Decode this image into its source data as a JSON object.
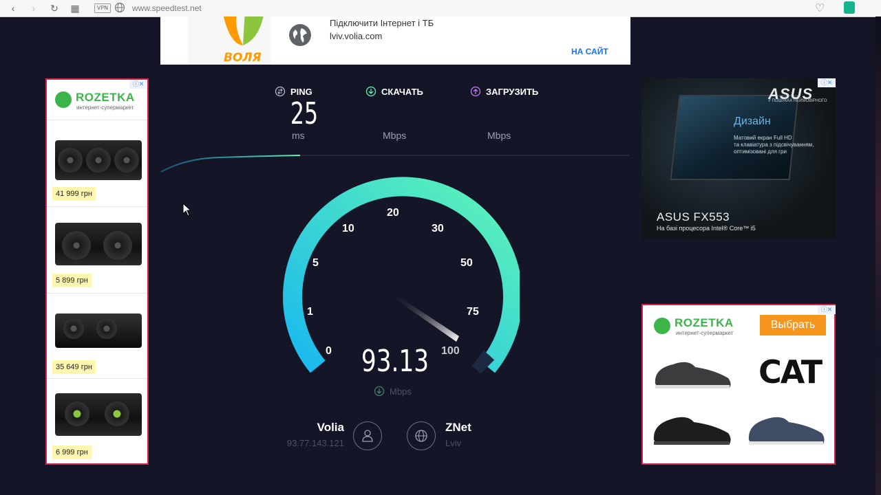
{
  "browser": {
    "back_icon": "‹",
    "forward_icon": "›",
    "reload_icon": "↻",
    "apps_icon": "▦",
    "vpn_label": "VPN",
    "url": "www.speedtest.net"
  },
  "top_ad": {
    "brand": "ВОЛЯ",
    "headline": "Підключити Інтернет і ТБ",
    "domain": "lviv.volia.com",
    "cta": "НА САЙТ"
  },
  "left_ad": {
    "brand": "ROZETKA",
    "subtitle": "интернет-супермаркет",
    "prices": [
      "41 999 грн",
      "5 899 грн",
      "35 649 грн",
      "6 999 грн"
    ]
  },
  "asus_ad": {
    "logo": "ASUS",
    "logo_sub": "У ПОШУКАХ НЕЙМОВІРНОГО",
    "screen_title": "Дизайн",
    "screen_desc_1": "Матовий екран Full HD",
    "screen_desc_2": "та клавіатура з підсвічуванням,",
    "screen_desc_3": "оптимізовані для гри",
    "model": "ASUS FX553",
    "model_sub": "На базі процесора Intel® Core™ i5"
  },
  "right_ad": {
    "brand": "ROZETKA",
    "subtitle": "интернет-супермаркет",
    "button": "Выбрать",
    "cat_logo": "CAT"
  },
  "speedtest": {
    "ping_label": "PING",
    "download_label": "СКАЧАТЬ",
    "upload_label": "ЗАГРУЗИТЬ",
    "ping_value": "25",
    "ping_unit": "ms",
    "download_unit": "Mbps",
    "upload_unit": "Mbps",
    "gauge_labels": [
      "0",
      "1",
      "5",
      "10",
      "20",
      "30",
      "50",
      "75",
      "100"
    ],
    "speed_value": "93.13",
    "speed_unit": "Mbps",
    "isp_name": "Volia",
    "isp_ip": "93.77.143.121",
    "server_name": "ZNet",
    "server_location": "Lviv"
  },
  "colors": {
    "background": "#141526",
    "gauge_start": "#1ab8ef",
    "gauge_end": "#5ff5b6",
    "ad_border": "#d6214a",
    "rozetka_green": "#3bb54a"
  }
}
